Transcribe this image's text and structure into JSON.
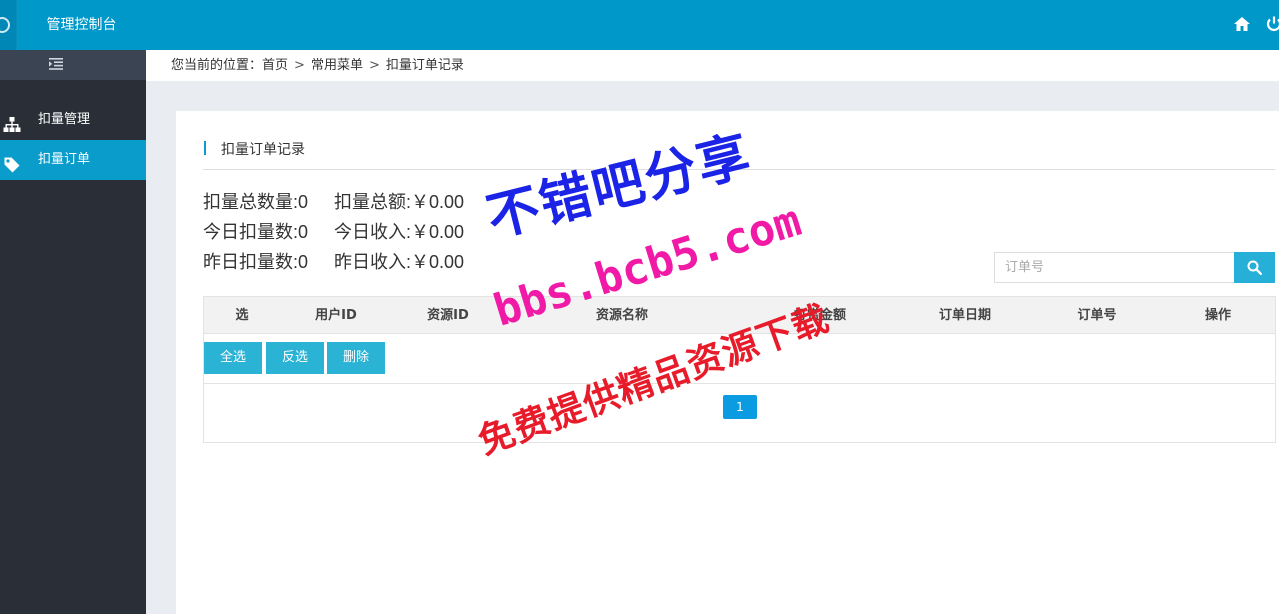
{
  "app": {
    "title": "管理控制台"
  },
  "topbar": {
    "home_icon": "home-icon",
    "power_icon": "power-icon"
  },
  "sidebar": {
    "collapse_icon": "indent-icon",
    "items": [
      {
        "label": "扣量管理",
        "icon": "sitemap-icon",
        "active": false
      },
      {
        "label": "扣量订单",
        "icon": "tag-icon",
        "active": true
      }
    ]
  },
  "breadcrumb": {
    "prefix": "您当前的位置：",
    "items": [
      "首页",
      "常用菜单",
      "扣量订单记录"
    ],
    "separator": ">"
  },
  "panel": {
    "title": "扣量订单记录"
  },
  "stats": [
    [
      "扣量总数量:0",
      "扣量总额:￥0.00"
    ],
    [
      "今日扣量数:0",
      "今日收入:￥0.00"
    ],
    [
      "昨日扣量数:0",
      "昨日收入:￥0.00"
    ]
  ],
  "search": {
    "placeholder": "订单号",
    "icon": "search-icon"
  },
  "table": {
    "columns": [
      "选",
      "用户ID",
      "资源ID",
      "资源名称",
      "打赏金额",
      "订单日期",
      "订单号",
      "操作"
    ],
    "rows": []
  },
  "actions": {
    "select_all": "全选",
    "invert": "反选",
    "delete": "删除"
  },
  "pagination": {
    "current": "1"
  },
  "watermark": {
    "line1": "不错吧分享",
    "line2": "bbs.bcb5.com",
    "line3": "免费提供精品资源下载"
  },
  "colors": {
    "topbar": "#0098c9",
    "sidebar": "#2a2f37",
    "accent": "#0a9ccb",
    "button": "#2bb3d6",
    "watermark_blue": "#1b23e6",
    "watermark_pink": "#f01aa6",
    "watermark_red": "#e81b2a"
  }
}
